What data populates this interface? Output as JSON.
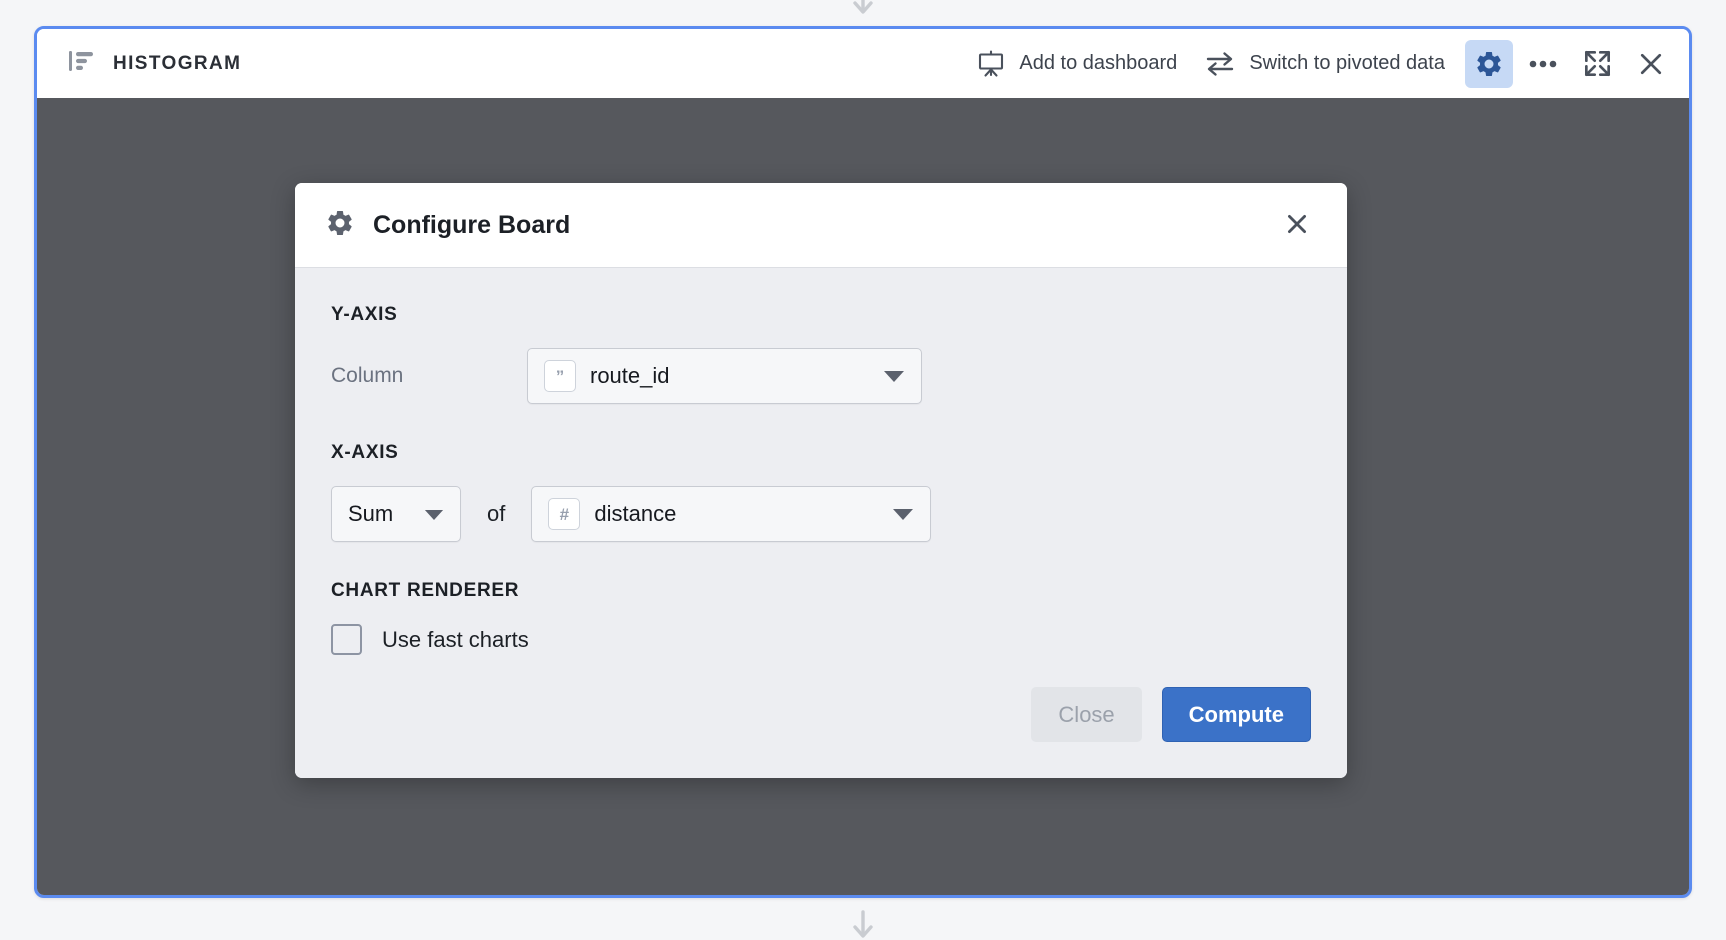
{
  "panel": {
    "title": "HISTOGRAM",
    "title_icon": "histogram-icon",
    "actions": [
      {
        "label": "Add to dashboard",
        "icon": "dashboard-icon"
      },
      {
        "label": "Switch to pivoted data",
        "icon": "swap-arrows-icon"
      }
    ],
    "icon_buttons": [
      {
        "name": "gear-icon",
        "active": true
      },
      {
        "name": "more-options-icon",
        "active": false
      },
      {
        "name": "expand-icon",
        "active": false
      },
      {
        "name": "close-icon",
        "active": false
      }
    ],
    "border_color": "#5b8bf0",
    "backdrop_color": "#56585d"
  },
  "drop_indicators": {
    "top_arrow": "arrow-down-icon",
    "bottom_arrow": "arrow-down-icon"
  },
  "modal": {
    "icon": "gear-icon",
    "title": "Configure Board",
    "close_icon": "close-icon",
    "sections": {
      "y_axis": {
        "heading": "Y-AXIS",
        "column_label": "Column",
        "column_value": "route_id",
        "column_type_icon": "string-type-icon",
        "column_type_glyph": "”"
      },
      "x_axis": {
        "heading": "X-AXIS",
        "aggregate_value": "Sum",
        "of_label": "of",
        "column_value": "distance",
        "column_type_icon": "number-type-icon",
        "column_type_glyph": "#"
      },
      "chart_renderer": {
        "heading": "CHART RENDERER",
        "checkbox_label": "Use fast charts",
        "checked": false
      }
    },
    "footer": {
      "close_label": "Close",
      "compute_label": "Compute"
    },
    "colors": {
      "primary": "#3b72c8",
      "secondary_bg": "#e2e4e8",
      "body_bg": "#edeef2"
    }
  }
}
